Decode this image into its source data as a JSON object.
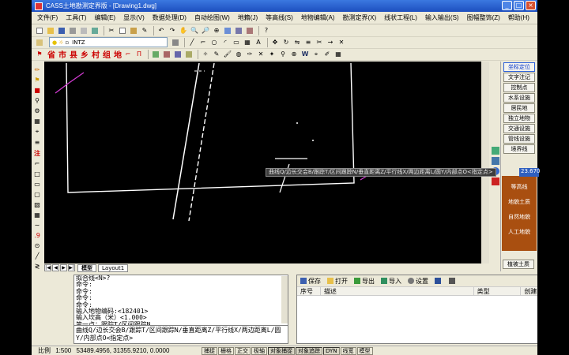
{
  "window": {
    "title": "CASS土地勘测定界版 - [Drawing1.dwg]"
  },
  "menu": [
    "文件(F)",
    "工具(T)",
    "编辑(E)",
    "显示(V)",
    "数据处理(D)",
    "自动绘图(W)",
    "地籍(J)",
    "等高线(S)",
    "地物编辑(A)",
    "勘测定界(X)",
    "线状工程(L)",
    "输入输出(S)",
    "图幅整饰(Z)",
    "帮助(H)"
  ],
  "toolbar": {
    "layer_name": "INTZ",
    "code_chars": [
      "省",
      "市",
      "县",
      "乡",
      "村",
      "组",
      "地"
    ]
  },
  "right_panel": {
    "items": [
      "坐标定位",
      "文字注记",
      "控制点",
      "水系设施",
      "居民地",
      "独立地物",
      "交通设施",
      "管线设施",
      "境界线"
    ],
    "brown_items": [
      "等高线",
      "地貌土质",
      "自然地貌",
      "人工地貌"
    ],
    "bottom_item": "植被土质"
  },
  "canvas": {
    "tooltip": "曲线Q/边长交会B/跟踪T/区间跟踪N/垂直距离Z/平行线X/两边距离L/圆Y/内部点O<指定点>",
    "tooltip_input": "23.670"
  },
  "tabs": {
    "model": "模型",
    "layout": "Layout1"
  },
  "command": {
    "lines": [
      "拟合线<N>?",
      "命令:",
      "命令:",
      "命令:",
      "命令:",
      "输入地物编码:<182401>",
      "输入坎高（米）<1.000>",
      "第一点：跟踪T/区间跟踪N"
    ],
    "input_text": "曲线Q/边长交会B/跟踪T/区间跟踪N/垂直距离Z/平行线X/两边距离L/圆Y/内部点O<指定点>"
  },
  "property_panel": {
    "buttons": [
      "保存",
      "打开",
      "导出",
      "导入",
      "设置"
    ],
    "columns": [
      "序号",
      "描述",
      "类型",
      "创建时间"
    ]
  },
  "status": {
    "scale": "比例",
    "scale_value": "1:500",
    "coords": "53489.4956, 31355.9210, 0.0000",
    "buttons": [
      "捕捉",
      "栅格",
      "正交",
      "极轴",
      "对象捕捉",
      "对象追踪",
      "DYN",
      "线宽",
      "模型"
    ]
  },
  "colors": {
    "title_bar": "#2a5fcf",
    "canvas": "#000000",
    "brown_panel": "#a94f10",
    "code_red": "#cc0000"
  }
}
